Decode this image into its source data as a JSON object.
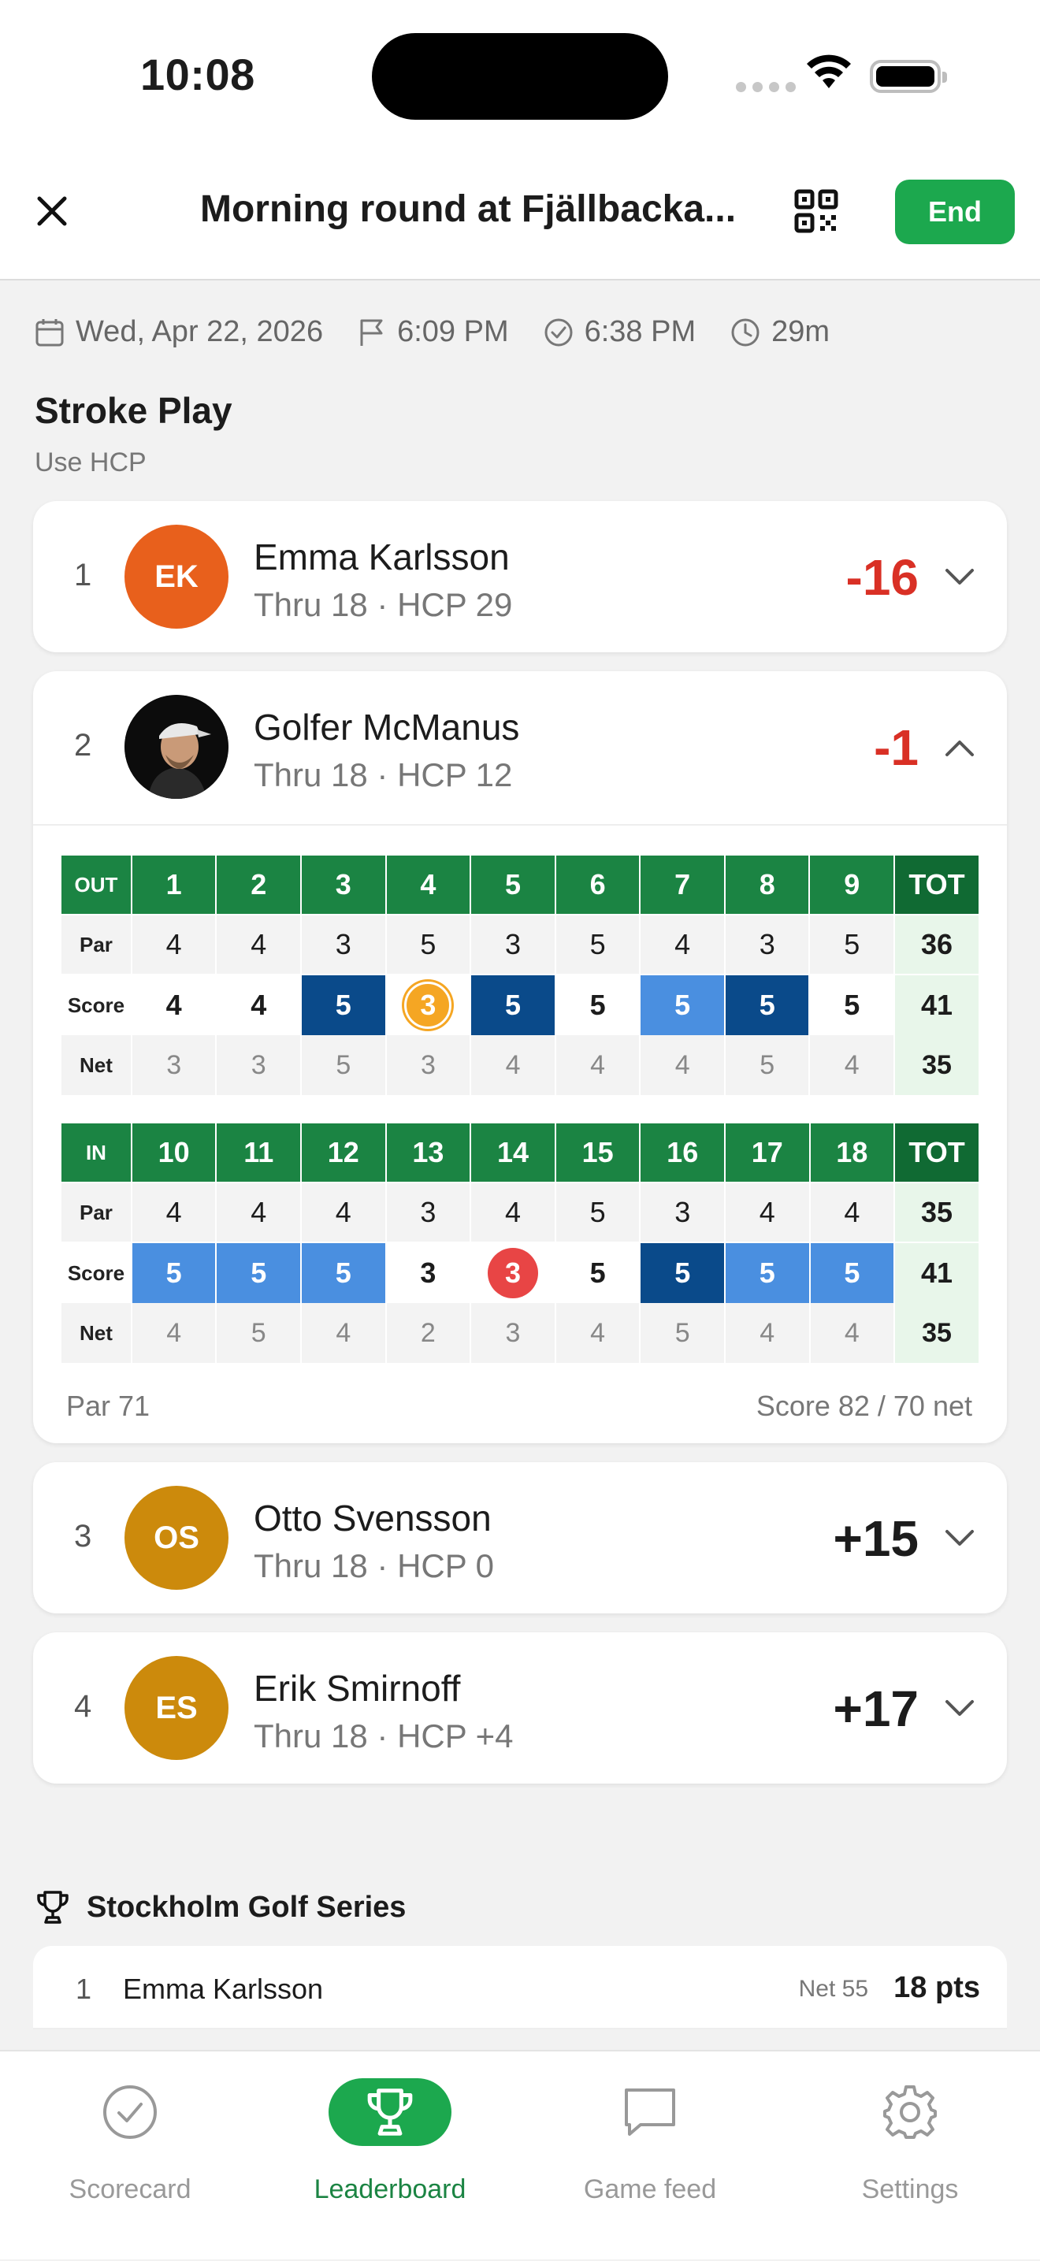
{
  "status_bar": {
    "time": "10:08"
  },
  "header": {
    "title": "Morning round at Fjällbacka...",
    "end_label": "End"
  },
  "round_meta": {
    "date": "Wed, Apr 22, 2026",
    "start": "6:09 PM",
    "finish": "6:38 PM",
    "duration": "29m"
  },
  "section": {
    "title": "Stroke Play",
    "subtitle": "Use HCP"
  },
  "players": [
    {
      "rank": "1",
      "initials": "EK",
      "name": "Emma Karlsson",
      "info": "Thru 18 · HCP 29",
      "score": "-16",
      "avatar_color": "#e8601c",
      "score_color": "#d93025"
    },
    {
      "rank": "2",
      "initials": "",
      "name": "Golfer McManus",
      "info": "Thru 18 · HCP 12",
      "score": "-1",
      "avatar_color": "#111111",
      "score_color": "#d93025"
    },
    {
      "rank": "3",
      "initials": "OS",
      "name": "Otto Svensson",
      "info": "Thru 18 · HCP 0",
      "score": "+15",
      "avatar_color": "#cc8a0c",
      "score_color": "#1c1c1c"
    },
    {
      "rank": "4",
      "initials": "ES",
      "name": "Erik Smirnoff",
      "info": "Thru 18 · HCP +4",
      "score": "+17",
      "avatar_color": "#cc8a0c",
      "score_color": "#1c1c1c"
    }
  ],
  "scorecard": {
    "out": {
      "label": "OUT",
      "tot_label": "TOT",
      "holes": [
        "1",
        "2",
        "3",
        "4",
        "5",
        "6",
        "7",
        "8",
        "9"
      ],
      "par": [
        "4",
        "4",
        "3",
        "5",
        "3",
        "5",
        "4",
        "3",
        "5"
      ],
      "par_tot": "36",
      "score": [
        "4",
        "4",
        "5",
        "3",
        "5",
        "5",
        "5",
        "5",
        "5"
      ],
      "score_tot": "41",
      "score_style": [
        "",
        "",
        "dk",
        "gold",
        "dk",
        "",
        "lt",
        "dk",
        ""
      ],
      "net": [
        "3",
        "3",
        "5",
        "3",
        "4",
        "4",
        "4",
        "5",
        "4"
      ],
      "net_tot": "35"
    },
    "in": {
      "label": "IN",
      "tot_label": "TOT",
      "holes": [
        "10",
        "11",
        "12",
        "13",
        "14",
        "15",
        "16",
        "17",
        "18"
      ],
      "par": [
        "4",
        "4",
        "4",
        "3",
        "4",
        "5",
        "3",
        "4",
        "4"
      ],
      "par_tot": "35",
      "score": [
        "5",
        "5",
        "5",
        "3",
        "3",
        "5",
        "5",
        "5",
        "5"
      ],
      "score_tot": "41",
      "score_style": [
        "lt",
        "lt",
        "lt",
        "",
        "red",
        "",
        "dk",
        "lt",
        "lt"
      ],
      "net": [
        "4",
        "5",
        "4",
        "2",
        "3",
        "4",
        "5",
        "4",
        "4"
      ],
      "net_tot": "35"
    },
    "row_labels": {
      "par": "Par",
      "score": "Score",
      "net": "Net"
    },
    "footer_par": "Par 71",
    "footer_score": "Score 82 / 70 net"
  },
  "series": {
    "title": "Stockholm Golf Series",
    "rows": [
      {
        "rank": "1",
        "name": "Emma Karlsson",
        "net": "Net 55",
        "points": "18 pts"
      }
    ]
  },
  "tabs": [
    {
      "label": "Scorecard",
      "icon": "check-circle-icon"
    },
    {
      "label": "Leaderboard",
      "icon": "trophy-icon"
    },
    {
      "label": "Game feed",
      "icon": "chat-bubble-icon"
    },
    {
      "label": "Settings",
      "icon": "gear-icon"
    }
  ]
}
